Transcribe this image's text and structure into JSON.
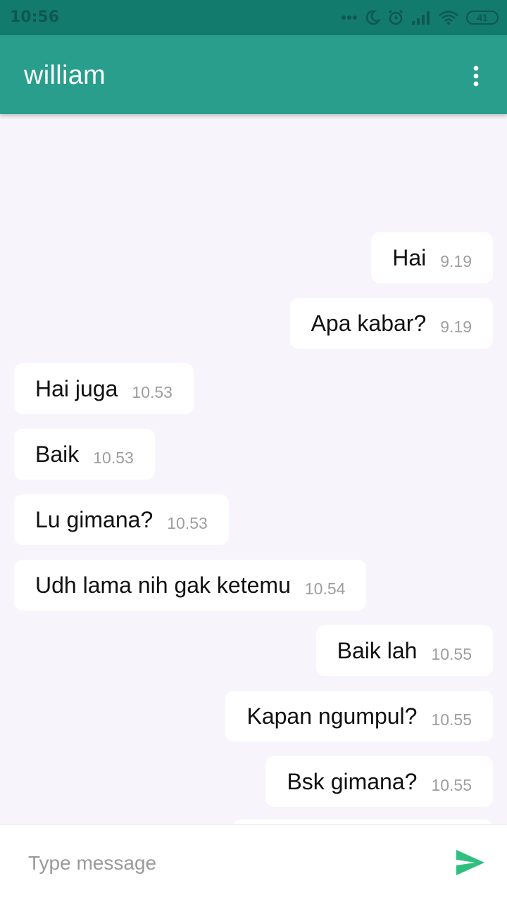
{
  "status_bar": {
    "time": "10:56",
    "battery": "41",
    "icons": [
      "dots-icon",
      "moon-icon",
      "alarm-icon",
      "signal-icon",
      "wifi-icon",
      "battery-icon"
    ]
  },
  "header": {
    "title": "william",
    "menu_icon": "more-vert-icon"
  },
  "messages": [
    {
      "text": "Hai",
      "time": "9.19",
      "direction": "out"
    },
    {
      "text": "Apa kabar?",
      "time": "9.19",
      "direction": "out"
    },
    {
      "text": "Hai juga",
      "time": "10.53",
      "direction": "in"
    },
    {
      "text": "Baik",
      "time": "10.53",
      "direction": "in"
    },
    {
      "text": "Lu gimana?",
      "time": "10.53",
      "direction": "in"
    },
    {
      "text": "Udh lama nih gak ketemu",
      "time": "10.54",
      "direction": "in"
    },
    {
      "text": "Baik lah",
      "time": "10.55",
      "direction": "out"
    },
    {
      "text": "Kapan ngumpul?",
      "time": "10.55",
      "direction": "out"
    },
    {
      "text": "Bsk gimana?",
      "time": "10.55",
      "direction": "out"
    }
  ],
  "composer": {
    "placeholder": "Type message",
    "value": "",
    "send_icon": "send-icon"
  },
  "colors": {
    "status_bar": "#137a6e",
    "app_bar": "#299e8d",
    "background": "#f7f5fb",
    "bubble": "#ffffff",
    "send_icon": "#2fbf7f"
  }
}
